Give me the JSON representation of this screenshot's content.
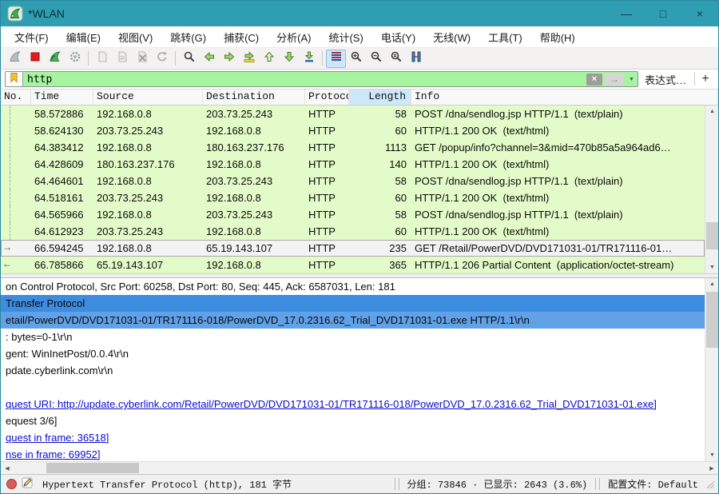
{
  "window": {
    "title": "*WLAN",
    "minimize_glyph": "—",
    "maximize_glyph": "□",
    "close_glyph": "×"
  },
  "menu": {
    "items": [
      "文件(F)",
      "编辑(E)",
      "视图(V)",
      "跳转(G)",
      "捕获(C)",
      "分析(A)",
      "统计(S)",
      "电话(Y)",
      "无线(W)",
      "工具(T)",
      "帮助(H)"
    ]
  },
  "toolbar": {
    "buttons": [
      "start-capture",
      "stop-capture",
      "restart-capture",
      "capture-options",
      "open-file",
      "save-file",
      "close-file",
      "reload-file",
      "find-packet",
      "go-back",
      "go-forward",
      "go-to-packet",
      "go-first",
      "go-last",
      "auto-scroll",
      "colorize",
      "zoom-in",
      "zoom-out",
      "zoom-reset",
      "resize-columns"
    ],
    "active_button": "colorize"
  },
  "filter": {
    "value": "http",
    "clear_glyph": "×",
    "apply_glyph": "→",
    "dropdown_glyph": "▼",
    "expression_label": "表达式…",
    "add_label": "+"
  },
  "icons": {
    "request_arrow": "→",
    "response_arrow": "←",
    "scroll_up": "▲",
    "scroll_down": "▼",
    "scroll_left": "◀",
    "scroll_right": "▶"
  },
  "packet_list": {
    "columns": {
      "no": "No.",
      "time": "Time",
      "source": "Source",
      "destination": "Destination",
      "protocol": "Protocol",
      "length": "Length",
      "info": "Info"
    },
    "sorted_column": "Length",
    "rows": [
      {
        "time": "58.572886",
        "source": "192.168.0.8",
        "destination": "203.73.25.243",
        "protocol": "HTTP",
        "length": "58",
        "info": "POST /dna/sendlog.jsp HTTP/1.1  (text/plain)"
      },
      {
        "time": "58.624130",
        "source": "203.73.25.243",
        "destination": "192.168.0.8",
        "protocol": "HTTP",
        "length": "60",
        "info": "HTTP/1.1 200 OK  (text/html)"
      },
      {
        "time": "64.383412",
        "source": "192.168.0.8",
        "destination": "180.163.237.176",
        "protocol": "HTTP",
        "length": "1113",
        "info": "GET /popup/info?channel=3&mid=470b85a5a964ad6…"
      },
      {
        "time": "64.428609",
        "source": "180.163.237.176",
        "destination": "192.168.0.8",
        "protocol": "HTTP",
        "length": "140",
        "info": "HTTP/1.1 200 OK  (text/html)"
      },
      {
        "time": "64.464601",
        "source": "192.168.0.8",
        "destination": "203.73.25.243",
        "protocol": "HTTP",
        "length": "58",
        "info": "POST /dna/sendlog.jsp HTTP/1.1  (text/plain)"
      },
      {
        "time": "64.518161",
        "source": "203.73.25.243",
        "destination": "192.168.0.8",
        "protocol": "HTTP",
        "length": "60",
        "info": "HTTP/1.1 200 OK  (text/html)"
      },
      {
        "time": "64.565966",
        "source": "192.168.0.8",
        "destination": "203.73.25.243",
        "protocol": "HTTP",
        "length": "58",
        "info": "POST /dna/sendlog.jsp HTTP/1.1  (text/plain)"
      },
      {
        "time": "64.612923",
        "source": "203.73.25.243",
        "destination": "192.168.0.8",
        "protocol": "HTTP",
        "length": "60",
        "info": "HTTP/1.1 200 OK  (text/html)"
      },
      {
        "time": "66.594245",
        "source": "192.168.0.8",
        "destination": "65.19.143.107",
        "protocol": "HTTP",
        "length": "235",
        "info": "GET /Retail/PowerDVD/DVD171031-01/TR171116-01…",
        "selected": true,
        "marker": "request-arrow"
      },
      {
        "time": "66.785866",
        "source": "65.19.143.107",
        "destination": "192.168.0.8",
        "protocol": "HTTP",
        "length": "365",
        "info": "HTTP/1.1 206 Partial Content  (application/octet-stream)",
        "marker": "response-arrow"
      }
    ]
  },
  "details": {
    "lines": [
      "on Control Protocol, Src Port: 60258, Dst Port: 80, Seq: 445, Ack: 6587031, Len: 181",
      "Transfer Protocol",
      "etail/PowerDVD/DVD171031-01/TR171116-018/PowerDVD_17.0.2316.62_Trial_DVD171031-01.exe HTTP/1.1\\r\\n",
      ": bytes=0-1\\r\\n",
      "gent: WinInetPost/0.0.4\\r\\n",
      "pdate.cyberlink.com\\r\\n",
      "",
      "quest URI: http://update.cyberlink.com/Retail/PowerDVD/DVD171031-01/TR171116-018/PowerDVD_17.0.2316.62_Trial_DVD171031-01.exe]",
      "equest 3/6]",
      "quest in frame: 36518]",
      "nse in frame: 69952]"
    ]
  },
  "status": {
    "selected_info": "Hypertext Transfer Protocol (http), 181 字节",
    "counts": "分组: 73846 · 已显示: 2643 (3.6%)",
    "profile": "配置文件: Default"
  },
  "colors": {
    "titlebar": "#2f9eb3",
    "filter_valid_bg": "#a7f4a0",
    "http_row_bg": "#e3fbc8",
    "selection_dark": "#3c8ce0",
    "selection_light": "#61a1e8",
    "sorted_header_bg": "#cde8f8",
    "link": "#0b0bd0"
  }
}
